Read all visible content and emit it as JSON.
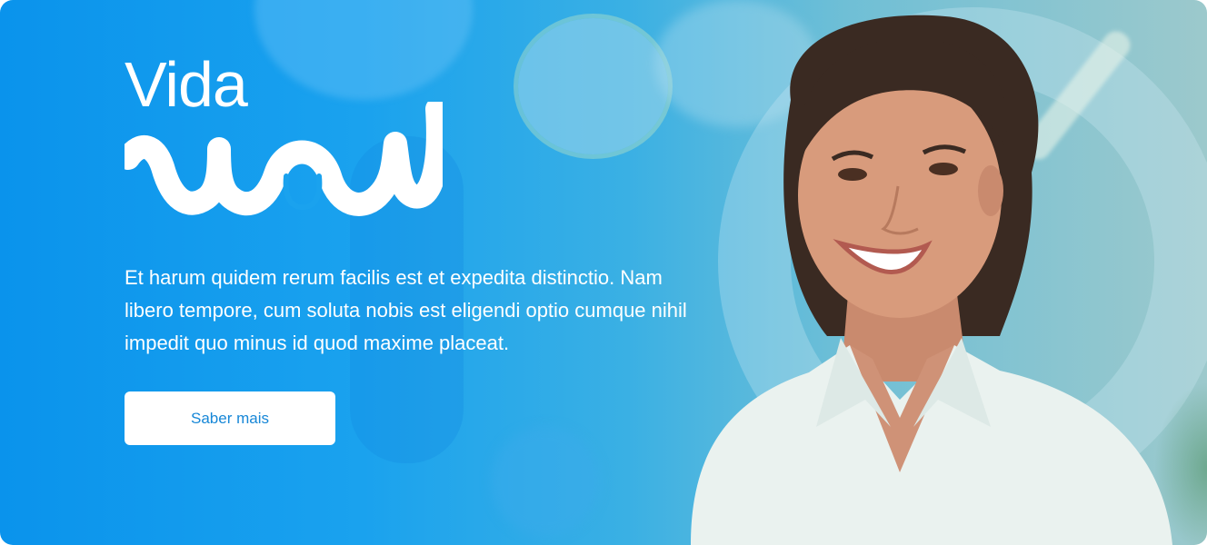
{
  "banner": {
    "eyebrow": "Vida",
    "logo_text": "WOW",
    "description": "Et harum quidem rerum facilis est et expedita distinctio. Nam libero tempore, cum soluta nobis est eligendi optio cumque nihil impedit quo minus id quod maxime placeat.",
    "cta_label": "Saber mais",
    "image_subject": "smiling woman in white blouse"
  },
  "colors": {
    "brand_blue": "#0a93ec",
    "button_text": "#1787d7",
    "button_background": "#ffffff",
    "text": "#ffffff"
  }
}
